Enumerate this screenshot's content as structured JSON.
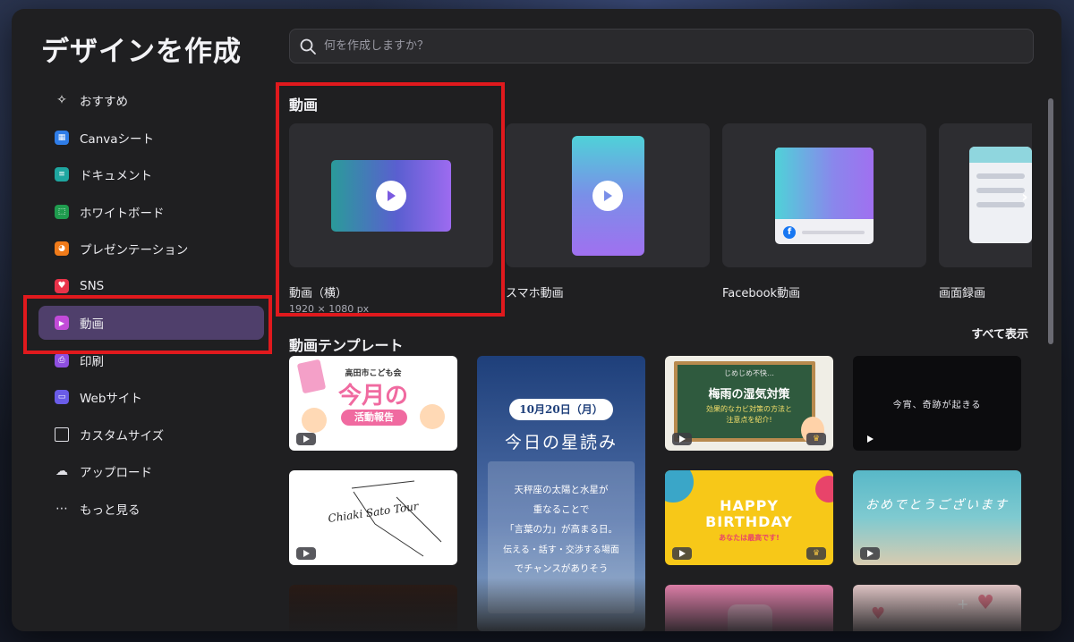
{
  "modal": {
    "title": "デザインを作成"
  },
  "search": {
    "placeholder": "何を作成しますか？"
  },
  "sidebar": {
    "items": [
      {
        "label": "おすすめ",
        "icon": "sparkle-icon"
      },
      {
        "label": "Canvaシート",
        "icon": "sheet-icon"
      },
      {
        "label": "ドキュメント",
        "icon": "document-icon"
      },
      {
        "label": "ホワイトボード",
        "icon": "whiteboard-icon"
      },
      {
        "label": "プレゼンテーション",
        "icon": "presentation-icon"
      },
      {
        "label": "SNS",
        "icon": "heart-icon"
      },
      {
        "label": "動画",
        "icon": "video-icon"
      },
      {
        "label": "印刷",
        "icon": "printer-icon"
      },
      {
        "label": "Webサイト",
        "icon": "website-icon"
      },
      {
        "label": "カスタムサイズ",
        "icon": "resize-icon"
      },
      {
        "label": "アップロード",
        "icon": "cloud-upload-icon"
      },
      {
        "label": "もっと見る",
        "icon": "more-dots-icon"
      }
    ],
    "active": "動画"
  },
  "video_section": {
    "title": "動画",
    "formats": [
      {
        "label": "動画（横）",
        "sub": "1920 × 1080 px"
      },
      {
        "label": "スマホ動画",
        "sub": ""
      },
      {
        "label": "Facebook動画",
        "sub": ""
      },
      {
        "label": "画面録画",
        "sub": ""
      }
    ]
  },
  "templates_section": {
    "title": "動画テンプレート",
    "show_all": "すべて表示",
    "t1": {
      "top": "高田市こども会",
      "main": "今月の",
      "sub": "活動報告"
    },
    "t2": {
      "date": "10月20日（月）",
      "title": "今日の星読み",
      "line1": "天秤座の太陽と水星が",
      "line2": "重なることで",
      "line3": "「言葉の力」が高まる日。",
      "line4": "伝える・話す・交渉する場面",
      "line5": "でチャンスがありそう"
    },
    "t3": {
      "top": "じめじめ不快…",
      "title": "梅雨の湿気対策",
      "line1": "効果的なカビ対策の方法と",
      "line2": "注意点を紹介!"
    },
    "t4": {
      "text": "今宵、奇跡が起きる"
    },
    "t5": {
      "text": "Chiaki Sato Tour"
    },
    "t6": {
      "line1": "HAPPY",
      "line2": "BIRTHDAY",
      "line3": "あなたは最高です!"
    },
    "t7": {
      "text": "おめでとうございます"
    }
  },
  "colors": {
    "accent_active": "#4f3f6b",
    "highlight_box": "#e0191d",
    "modal_bg": "#1f1f21"
  }
}
